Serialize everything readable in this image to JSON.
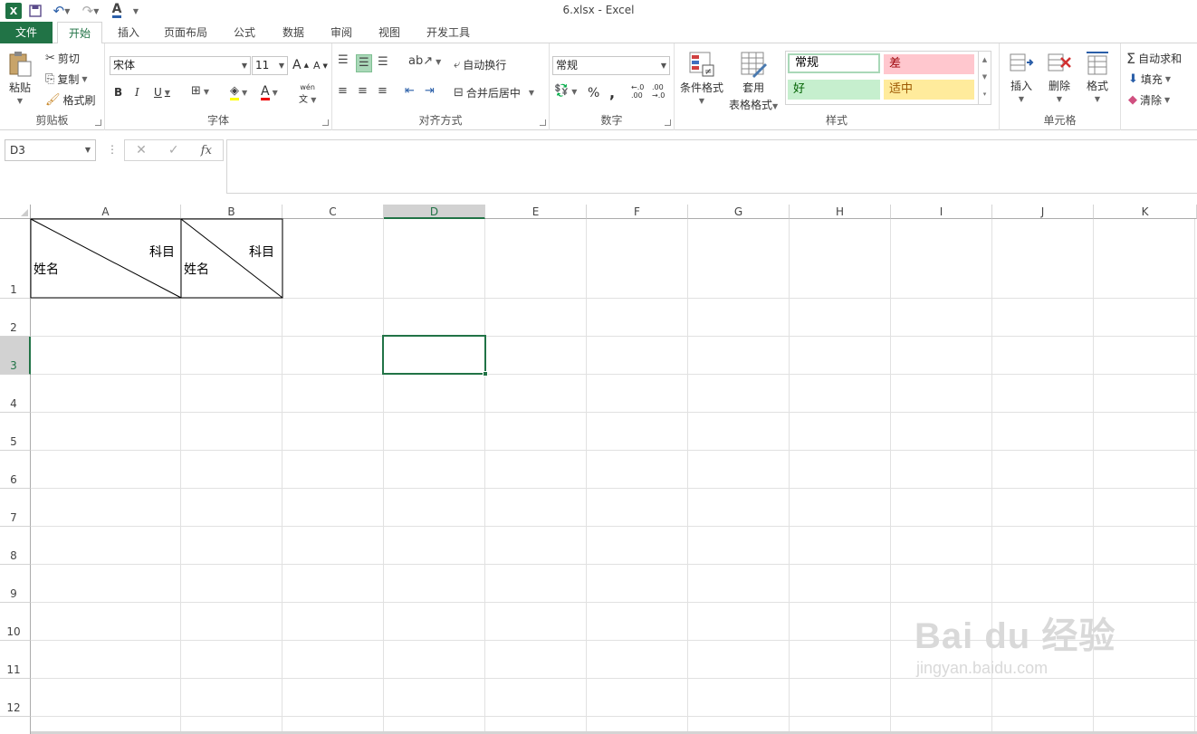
{
  "window": {
    "title": "6.xlsx - Excel"
  },
  "qat": {
    "excel_logo": "X",
    "font_color_letter": "A"
  },
  "tabs": [
    "文件",
    "开始",
    "插入",
    "页面布局",
    "公式",
    "数据",
    "审阅",
    "视图",
    "开发工具"
  ],
  "active_tab": "开始",
  "ribbon": {
    "clipboard": {
      "paste": "粘贴",
      "cut": "剪切",
      "copy": "复制",
      "format_painter": "格式刷",
      "label": "剪贴板"
    },
    "font": {
      "name": "宋体",
      "size": "11",
      "grow": "A",
      "shrink": "A",
      "bold": "B",
      "italic": "I",
      "underline": "U",
      "font_color": "A",
      "phonetic": "wén",
      "label": "字体"
    },
    "alignment": {
      "wrap_text": "自动换行",
      "merge_center": "合并后居中",
      "label": "对齐方式"
    },
    "number": {
      "format": "常规",
      "percent": "%",
      "comma": ",",
      "inc_decimal": "←.0 .00",
      "dec_decimal": ".00 →.0",
      "label": "数字"
    },
    "styles": {
      "conditional": "条件格式",
      "table_format_line1": "套用",
      "table_format_line2": "表格格式",
      "normal": "常规",
      "bad": "差",
      "good": "好",
      "neutral": "适中",
      "label": "样式"
    },
    "cells": {
      "insert": "插入",
      "delete": "删除",
      "format": "格式",
      "label": "单元格"
    },
    "editing": {
      "autosum": "自动求和",
      "fill": "填充",
      "clear": "清除"
    }
  },
  "formula_bar": {
    "name_box": "D3",
    "fx": "fx",
    "value": ""
  },
  "columns": [
    "A",
    "B",
    "C",
    "D",
    "E",
    "F",
    "G",
    "H",
    "I",
    "J",
    "K"
  ],
  "rows": [
    "1",
    "2",
    "3",
    "4",
    "5",
    "6",
    "7",
    "8",
    "9",
    "10",
    "11",
    "12"
  ],
  "selected_cell": "D3",
  "cells": {
    "A1_top_right": "科目",
    "A1_bottom_left": "姓名",
    "B1_top_right": "科目",
    "B1_bottom_left": "姓名"
  },
  "watermark": {
    "main": "Bai du 经验",
    "sub": "jingyan.baidu.com"
  },
  "colors": {
    "accent": "#217346",
    "bad_bg": "#ffc7ce",
    "bad_fg": "#9c0006",
    "good_bg": "#c6efce",
    "good_fg": "#006100",
    "neutral_bg": "#ffeb9c",
    "neutral_fg": "#9c5700"
  }
}
